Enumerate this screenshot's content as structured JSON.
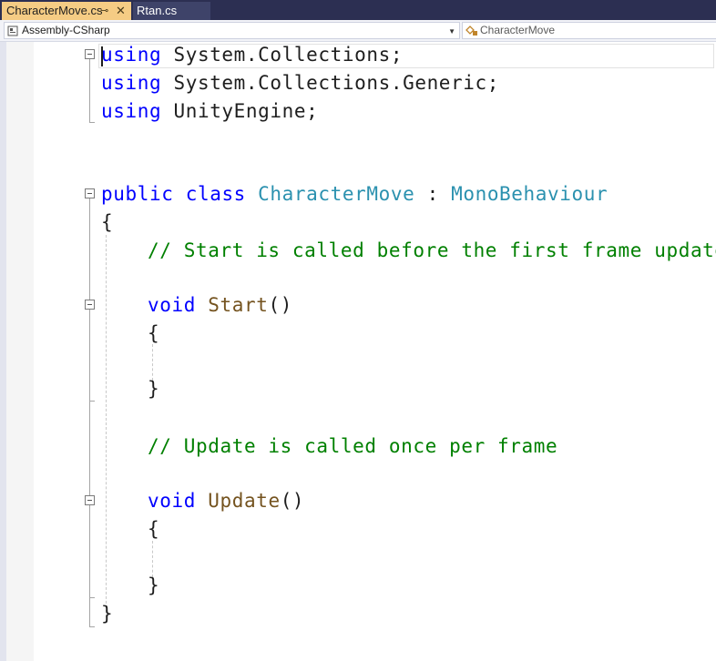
{
  "tabs": [
    {
      "label": "CharacterMove.cs",
      "active": true,
      "pin_glyph": "⊸",
      "close_glyph": "✕"
    },
    {
      "label": "Rtan.cs",
      "active": false
    }
  ],
  "navbar": {
    "project_dropdown": "Assembly-CSharp",
    "type_dropdown": "CharacterMove"
  },
  "code": {
    "line1": {
      "kw": "using",
      "rest": " System.Collections;"
    },
    "line2": {
      "kw": "using",
      "rest": " System.Collections.Generic;"
    },
    "line3": {
      "kw": "using",
      "rest": " UnityEngine;"
    },
    "line4": {
      "kw1": "public",
      "kw2": " class",
      "type": " CharacterMove",
      "colon": " :",
      "base": " MonoBehaviour"
    },
    "line5": "{",
    "line6": "// Start is called before the first frame update",
    "line7": {
      "kw": "void",
      "fn": " Start",
      "rest": "()"
    },
    "line8": "{",
    "line9": "}",
    "line10": "// Update is called once per frame",
    "line11": {
      "kw": "void",
      "fn": " Update",
      "rest": "()"
    },
    "line12": "{",
    "line13": "}",
    "line14": "}"
  },
  "colors": {
    "keyword": "#0000ff",
    "type": "#2b91af",
    "comment": "#008000",
    "method": "#74531f",
    "active_tab": "#f5cc84",
    "tab_strip": "#2c2f52"
  }
}
